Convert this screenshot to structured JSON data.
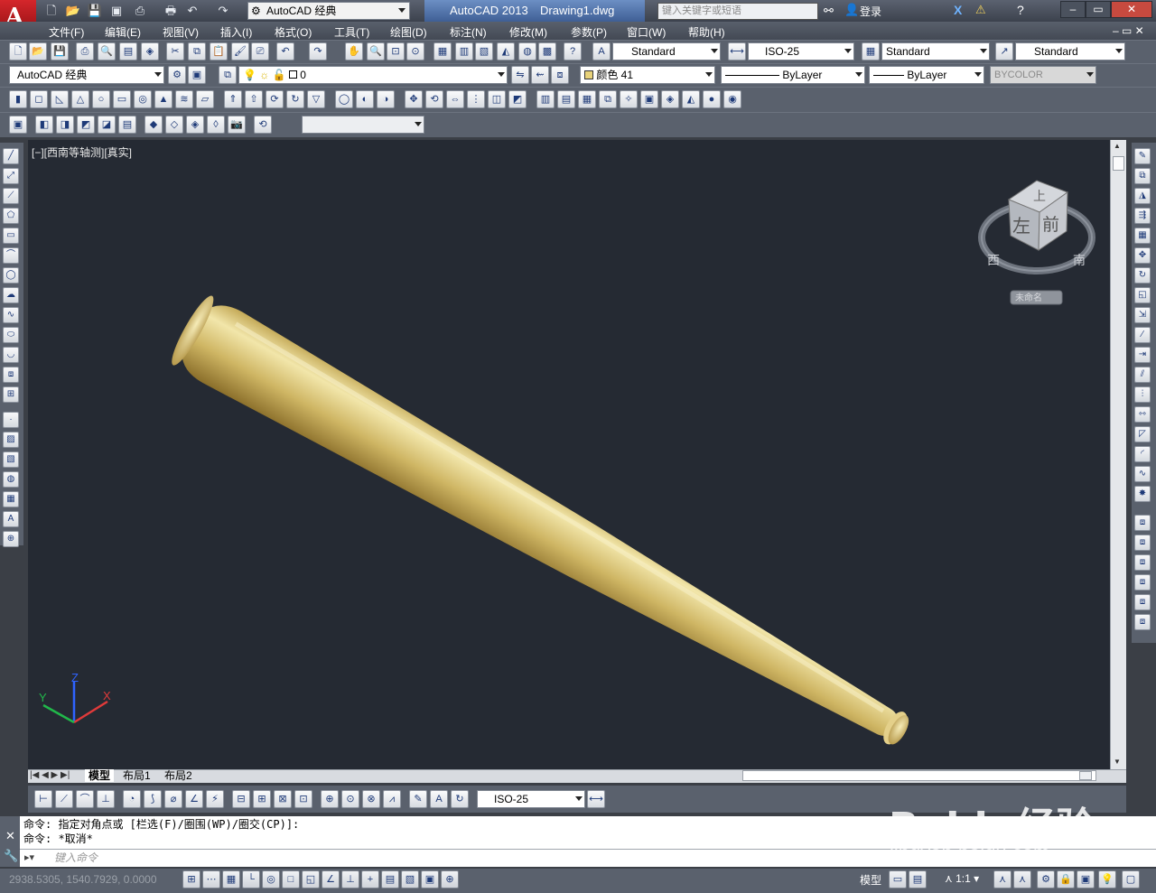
{
  "app": {
    "title_app": "AutoCAD 2013",
    "title_file": "Drawing1.dwg",
    "workspace": "AutoCAD 经典",
    "search_placeholder": "键入关键字或短语",
    "login": "登录"
  },
  "menu": [
    "文件(F)",
    "编辑(E)",
    "视图(V)",
    "插入(I)",
    "格式(O)",
    "工具(T)",
    "绘图(D)",
    "标注(N)",
    "修改(M)",
    "参数(P)",
    "窗口(W)",
    "帮助(H)"
  ],
  "styles": {
    "text_style": "Standard",
    "dim_style": "ISO-25",
    "table_style": "Standard",
    "multileader_style": "Standard"
  },
  "layers": {
    "workspace_combo": "AutoCAD 经典",
    "current_layer": "0",
    "color": "颜色 41",
    "linetype": "ByLayer",
    "lineweight": "ByLayer",
    "plotstyle": "BYCOLOR"
  },
  "viewport": {
    "label": "[−][西南等轴测][真实]",
    "viewcube_top": "上",
    "viewcube_left": "左",
    "viewcube_front": "前",
    "compass_west": "西",
    "compass_south": "南",
    "ucs_name": "未命名",
    "axis_x": "X",
    "axis_y": "Y",
    "axis_z": "Z"
  },
  "tabs": [
    "模型",
    "布局1",
    "布局2"
  ],
  "dim_toolbar_style": "ISO-25",
  "command": {
    "line1": "命令: 指定对角点或 [栏选(F)/圈围(WP)/圈交(CP)]:",
    "line2": "命令: *取消*",
    "input_placeholder": "键入命令"
  },
  "status": {
    "coords": "2938.5305, 1540.7929, 0.0000",
    "model_label": "模型",
    "scale": "1:1"
  },
  "watermark": {
    "brand": "Baidu经验",
    "url": "jingyan.baidu.com"
  },
  "colors": {
    "model_bg": "#252a33",
    "bat_gold": "#d8c378",
    "ui_gray": "#5a616d"
  }
}
